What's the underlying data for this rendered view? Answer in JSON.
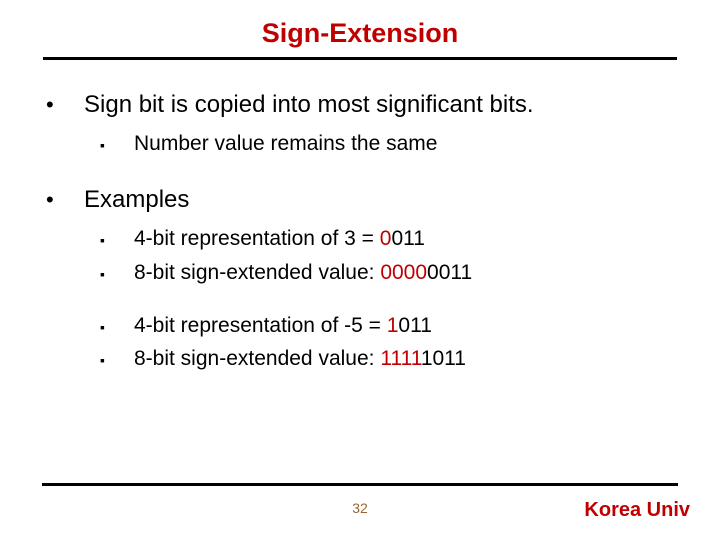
{
  "title": "Sign-Extension",
  "b1": {
    "text": "Sign bit is copied into most significant bits."
  },
  "b1_1": {
    "text": "Number value remains the same"
  },
  "b2": {
    "text": "Examples"
  },
  "b2_1": {
    "pre": "4-bit representation of 3 = ",
    "hl": "0",
    "post": "011"
  },
  "b2_2": {
    "pre": "8-bit sign-extended value: ",
    "hl": "0000",
    "post": "0011"
  },
  "b2_3": {
    "pre": "4-bit representation of -5 = ",
    "hl": "1",
    "post": "011"
  },
  "b2_4": {
    "pre": "8-bit sign-extended value: ",
    "hl": "1111",
    "post": "1011"
  },
  "page": "32",
  "footer": "Korea Univ",
  "bullets": {
    "disc": "•",
    "square": "▪"
  }
}
